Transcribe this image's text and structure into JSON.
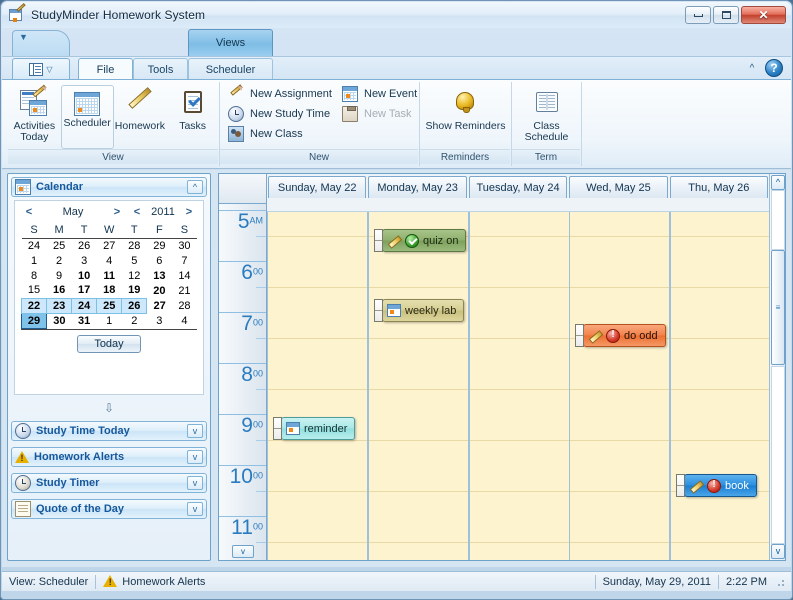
{
  "window": {
    "title": "StudyMinder Homework System",
    "app_icon": "calendar-pencil-icon",
    "controls": {
      "minimize": "–",
      "maximize": "□",
      "close": "✕"
    }
  },
  "quick_access": {
    "dropdown_arrow": "▼",
    "views_tab_label": "Views"
  },
  "ribbon": {
    "app_menu_arrow": "▽",
    "tabs": [
      {
        "label": "File",
        "active": true
      },
      {
        "label": "Tools",
        "active": false
      },
      {
        "label": "Scheduler",
        "active": false
      }
    ],
    "collapse_icon": "^",
    "help_icon": "?",
    "groups": [
      {
        "label": "View",
        "buttons": [
          {
            "label_line1": "Activities",
            "label_line2": "Today",
            "icon": "activities-today-icon",
            "selected": false
          },
          {
            "label_line1": "Scheduler",
            "label_line2": "",
            "icon": "calendar-icon",
            "selected": true
          },
          {
            "label_line1": "Homework",
            "label_line2": "",
            "icon": "pencil-icon",
            "selected": false
          },
          {
            "label_line1": "Tasks",
            "label_line2": "",
            "icon": "clipboard-check-icon",
            "selected": false
          }
        ]
      },
      {
        "label": "New",
        "items": [
          {
            "label": "New Assignment",
            "icon": "pencil-icon",
            "disabled": false
          },
          {
            "label": "New Study Time",
            "icon": "clock-icon",
            "disabled": false
          },
          {
            "label": "New Class",
            "icon": "people-icon",
            "disabled": false
          }
        ],
        "items2": [
          {
            "label": "New Event",
            "icon": "calendar-icon",
            "disabled": false
          },
          {
            "label": "New Task",
            "icon": "task-icon",
            "disabled": true
          }
        ]
      },
      {
        "label": "Reminders",
        "buttons": [
          {
            "label_line1": "Show Reminders",
            "label_line2": "",
            "icon": "bell-icon",
            "selected": false
          }
        ]
      },
      {
        "label": "Term",
        "buttons": [
          {
            "label_line1": "Class",
            "label_line2": "Schedule",
            "icon": "book-icon",
            "selected": false
          }
        ]
      }
    ]
  },
  "sidebar": {
    "panels": [
      {
        "title": "Calendar",
        "icon": "calendar-icon",
        "chevron": "^",
        "expanded": true
      },
      {
        "title": "Study Time Today",
        "icon": "clock-icon",
        "chevron": "v",
        "expanded": false
      },
      {
        "title": "Homework Alerts",
        "icon": "warning-icon",
        "chevron": "v",
        "expanded": false
      },
      {
        "title": "Study Timer",
        "icon": "stopwatch-icon",
        "chevron": "v",
        "expanded": false
      },
      {
        "title": "Quote of the Day",
        "icon": "note-icon",
        "chevron": "v",
        "expanded": false
      }
    ],
    "calendar": {
      "prev_month": "<",
      "month": "May",
      "next_month": ">",
      "prev_year": "<",
      "year": "2011",
      "next_year": ">",
      "weekday_headers": [
        "S",
        "M",
        "T",
        "W",
        "T",
        "F",
        "S"
      ],
      "weeks": [
        [
          {
            "d": "24",
            "t": "other"
          },
          {
            "d": "25",
            "t": "other"
          },
          {
            "d": "26",
            "t": "other"
          },
          {
            "d": "27",
            "t": "other"
          },
          {
            "d": "28",
            "t": "other"
          },
          {
            "d": "29",
            "t": "other"
          },
          {
            "d": "30",
            "t": "other"
          }
        ],
        [
          {
            "d": "1",
            "t": "weekend"
          },
          {
            "d": "2",
            "t": "normal"
          },
          {
            "d": "3",
            "t": "normal"
          },
          {
            "d": "4",
            "t": "normal"
          },
          {
            "d": "5",
            "t": "normal"
          },
          {
            "d": "6",
            "t": "normal"
          },
          {
            "d": "7",
            "t": "weekend"
          }
        ],
        [
          {
            "d": "8",
            "t": "weekend"
          },
          {
            "d": "9",
            "t": "normal"
          },
          {
            "d": "10",
            "t": "bold"
          },
          {
            "d": "11",
            "t": "bold"
          },
          {
            "d": "12",
            "t": "normal"
          },
          {
            "d": "13",
            "t": "bold"
          },
          {
            "d": "14",
            "t": "weekend"
          }
        ],
        [
          {
            "d": "15",
            "t": "weekend"
          },
          {
            "d": "16",
            "t": "bold"
          },
          {
            "d": "17",
            "t": "bold"
          },
          {
            "d": "18",
            "t": "bold"
          },
          {
            "d": "19",
            "t": "bold"
          },
          {
            "d": "20",
            "t": "bold"
          },
          {
            "d": "21",
            "t": "weekend"
          }
        ],
        [
          {
            "d": "22",
            "t": "selected"
          },
          {
            "d": "23",
            "t": "selected"
          },
          {
            "d": "24",
            "t": "selected"
          },
          {
            "d": "25",
            "t": "selected"
          },
          {
            "d": "26",
            "t": "selected"
          },
          {
            "d": "27",
            "t": "bold"
          },
          {
            "d": "28",
            "t": "weekend"
          }
        ],
        [
          {
            "d": "29",
            "t": "today"
          },
          {
            "d": "30",
            "t": "bold"
          },
          {
            "d": "31",
            "t": "bold"
          },
          {
            "d": "1",
            "t": "other"
          },
          {
            "d": "2",
            "t": "other"
          },
          {
            "d": "3",
            "t": "other"
          },
          {
            "d": "4",
            "t": "other"
          }
        ]
      ],
      "today_button": "Today",
      "collapse_arrow": "⇩"
    }
  },
  "scheduler": {
    "day_headers": [
      "Sunday, May 22",
      "Monday, May 23",
      "Tuesday, May 24",
      "Wed, May 25",
      "Thu, May 26"
    ],
    "time_slots": [
      {
        "hour": "5",
        "minutes": "AM"
      },
      {
        "hour": "6",
        "minutes": "00"
      },
      {
        "hour": "7",
        "minutes": "00"
      },
      {
        "hour": "8",
        "minutes": "00"
      },
      {
        "hour": "9",
        "minutes": "00"
      },
      {
        "hour": "10",
        "minutes": "00"
      },
      {
        "hour": "11",
        "minutes": "00"
      }
    ],
    "appointments": [
      {
        "label": "quiz on",
        "color": "green",
        "icons": [
          "pencil-icon",
          "check-circle-icon"
        ],
        "day": 1,
        "slot": 0,
        "offset": 17
      },
      {
        "label": "weekly lab",
        "color": "olive",
        "icons": [
          "calendar-icon"
        ],
        "day": 1,
        "slot": 1,
        "offset": 36
      },
      {
        "label": "do odd",
        "color": "orange",
        "icons": [
          "pencil-icon",
          "info-circle-icon"
        ],
        "day": 3,
        "slot": 2,
        "offset": 10
      },
      {
        "label": "reminder",
        "color": "cyan",
        "icons": [
          "calendar-icon"
        ],
        "day": 0,
        "slot": 4,
        "offset": 1
      },
      {
        "label": "book",
        "color": "blue",
        "icons": [
          "pencil-icon",
          "info-circle-icon"
        ],
        "day": 4,
        "slot": 5,
        "offset": 7
      }
    ],
    "scrollbar": {
      "up_arrow": "^",
      "down_arrow": "v",
      "thumb_grip": "≡"
    },
    "timecol_scroll_down": "v"
  },
  "statusbar": {
    "view_label": "View: Scheduler",
    "alerts_label": "Homework Alerts",
    "alerts_icon": "warning-icon",
    "date": "Sunday, May 29, 2011",
    "time": "2:22 PM"
  },
  "colors": {
    "title_text": "#12293f",
    "panel_title": "#15589c",
    "time_text": "#2a7bbf",
    "grid_bg": "#fdf3cf",
    "weekend_red": "#e00000",
    "selected_blue": "#0a3fa8",
    "today_bg": "#7fc3ea"
  }
}
